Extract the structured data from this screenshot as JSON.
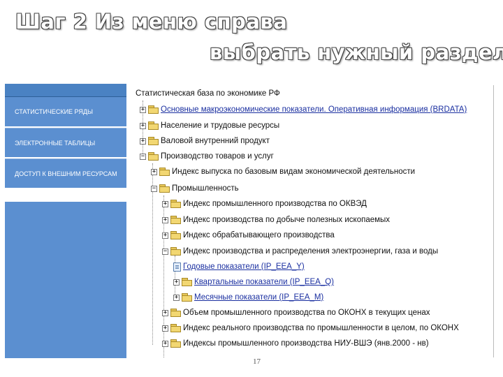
{
  "heading": {
    "line1": "Шаг 2 Из меню справа",
    "line2": "выбрать нужный раздел"
  },
  "sidebar": {
    "items": [
      {
        "label": "СТАТИСТИЧЕСКИЕ РЯДЫ"
      },
      {
        "label": "ЭЛЕКТРОННЫЕ ТАБЛИЦЫ"
      },
      {
        "label": "ДОСТУП К ВНЕШНИМ РЕСУРСАМ"
      }
    ]
  },
  "tree": {
    "root": "Статистическая база по экономике РФ",
    "nodes": [
      {
        "label": "Основные макроэкономические показатели. Оперативная информация (BRDATA)",
        "toggle": "+",
        "icon": "folder-icon",
        "link": true
      },
      {
        "label": "Население и трудовые ресурсы",
        "toggle": "+",
        "icon": "folder-icon",
        "link": false
      },
      {
        "label": "Валовой внутренний продукт",
        "toggle": "+",
        "icon": "folder-icon",
        "link": false
      },
      {
        "label": "Производство товаров и услуг",
        "toggle": "−",
        "icon": "folder-icon",
        "link": false
      },
      {
        "label": "Индекс выпуска по базовым видам экономической деятельности",
        "toggle": "+",
        "icon": "folder-icon",
        "link": false
      },
      {
        "label": "Промышленность",
        "toggle": "−",
        "icon": "folder-icon",
        "link": false
      },
      {
        "label": "Индекс промышленного производства по ОКВЭД",
        "toggle": "+",
        "icon": "folder-icon",
        "link": false
      },
      {
        "label": "Индекс производства по добыче полезных ископаемых",
        "toggle": "+",
        "icon": "folder-icon",
        "link": false
      },
      {
        "label": "Индекс обрабатывающего производства",
        "toggle": "+",
        "icon": "folder-icon",
        "link": false
      },
      {
        "label": "Индекс производства и распределения электроэнергии, газа и воды",
        "toggle": "−",
        "icon": "folder-icon",
        "link": false
      },
      {
        "label": "Годовые показатели (IP_EEA_Y)",
        "toggle": "",
        "icon": "document-icon",
        "link": true
      },
      {
        "label": "Квартальные показатели (IP_EEA_Q)",
        "toggle": "+",
        "icon": "folder-icon",
        "link": true
      },
      {
        "label": "Месячные показатели (IP_EEA_M)",
        "toggle": "+",
        "icon": "folder-icon",
        "link": true
      },
      {
        "label": "Объем промышленного производства по ОКОНХ в текущих ценах",
        "toggle": "+",
        "icon": "folder-icon",
        "link": false
      },
      {
        "label": "Индекс реального производства по промышленности в целом, по ОКОНХ",
        "toggle": "+",
        "icon": "folder-icon",
        "link": false
      },
      {
        "label": "Индексы промышленного производства НИУ-ВШЭ (янв.2000 - нв)",
        "toggle": "+",
        "icon": "folder-icon",
        "link": false
      }
    ]
  },
  "page_number": "17",
  "colors": {
    "sidebar": "#5b8fd0",
    "link": "#1a2fa0",
    "folder": "#f2d772"
  }
}
